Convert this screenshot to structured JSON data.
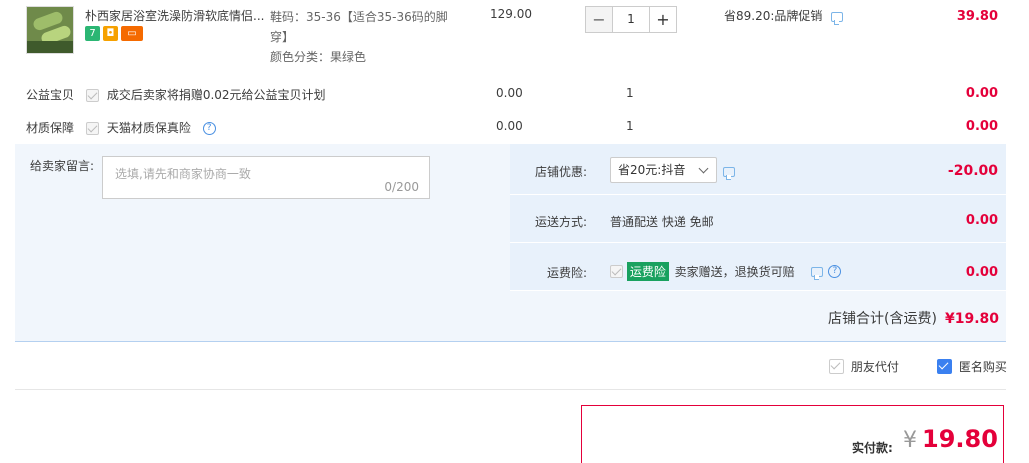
{
  "product": {
    "title": "朴西家居浴室洗澡防滑软底情侣...",
    "sku_size": "鞋码：35-36【适合35-36码的脚穿】",
    "sku_color": "颜色分类：果绿色",
    "price": "129.00",
    "quantity": "1",
    "minus": "−",
    "plus": "+",
    "promo": "省89.20:品牌促销",
    "subtotal": "39.80",
    "badges": [
      "7",
      "",
      ""
    ]
  },
  "charity": {
    "label": "公益宝贝",
    "text": "成交后卖家将捐赠0.02元给公益宝贝计划",
    "price": "0.00",
    "qty": "1",
    "amount": "0.00"
  },
  "material": {
    "label": "材质保障",
    "text": "天猫材质保真险",
    "price": "0.00",
    "qty": "1",
    "amount": "0.00"
  },
  "memo": {
    "label": "给卖家留言:",
    "placeholder": "选填,请先和商家协商一致",
    "counter": "0/200"
  },
  "shop_discount": {
    "label": "店铺优惠:",
    "selected": "省20元:抖音",
    "amount": "-20.00"
  },
  "shipping": {
    "label": "运送方式:",
    "text": "普通配送 快递 免邮",
    "amount": "0.00"
  },
  "insurance": {
    "label": "运费险:",
    "tag": "运费险",
    "text": "卖家赠送，退换货可赔",
    "amount": "0.00"
  },
  "shop_total": {
    "label": "店铺合计(含运费)",
    "amount": "¥19.80"
  },
  "options": {
    "friend_pay": "朋友代付",
    "anonymous": "匿名购买",
    "anonymous_checked": true
  },
  "payment": {
    "label": "实付款:",
    "yen": "¥",
    "amount": "19.80"
  },
  "colors": {
    "accent_red": "#e4003a",
    "panel_blue": "#f1f6fc",
    "check_blue": "#3a80f0",
    "tag_green": "#19a15f"
  }
}
